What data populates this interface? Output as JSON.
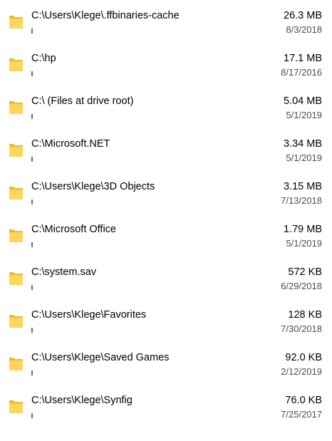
{
  "folders": [
    {
      "path": "C:\\Users\\Klege\\.ffbinaries-cache",
      "size": "26.3 MB",
      "date": "8/3/2018",
      "icon": "folder-icon"
    },
    {
      "path": "C:\\hp",
      "size": "17.1 MB",
      "date": "8/17/2016",
      "icon": "folder-icon"
    },
    {
      "path": "C:\\ (Files at drive root)",
      "size": "5.04 MB",
      "date": "5/1/2019",
      "icon": "folder-icon"
    },
    {
      "path": "C:\\Microsoft.NET",
      "size": "3.34 MB",
      "date": "5/1/2019",
      "icon": "folder-icon"
    },
    {
      "path": "C:\\Users\\Klege\\3D Objects",
      "size": "3.15 MB",
      "date": "7/13/2018",
      "icon": "folder-icon"
    },
    {
      "path": "C:\\Microsoft Office",
      "size": "1.79 MB",
      "date": "5/1/2019",
      "icon": "folder-icon"
    },
    {
      "path": "C:\\system.sav",
      "size": "572 KB",
      "date": "6/29/2018",
      "icon": "folder-icon"
    },
    {
      "path": "C:\\Users\\Klege\\Favorites",
      "size": "128 KB",
      "date": "7/30/2018",
      "icon": "folder-icon"
    },
    {
      "path": "C:\\Users\\Klege\\Saved Games",
      "size": "92.0 KB",
      "date": "2/12/2019",
      "icon": "folder-icon"
    },
    {
      "path": "C:\\Users\\Klege\\Synfig",
      "size": "76.0 KB",
      "date": "7/25/2017",
      "icon": "folder-icon"
    }
  ],
  "colors": {
    "folder_front": "#FFD65C",
    "folder_back": "#E8B83A",
    "usage_bar": "#6b6b6b"
  }
}
